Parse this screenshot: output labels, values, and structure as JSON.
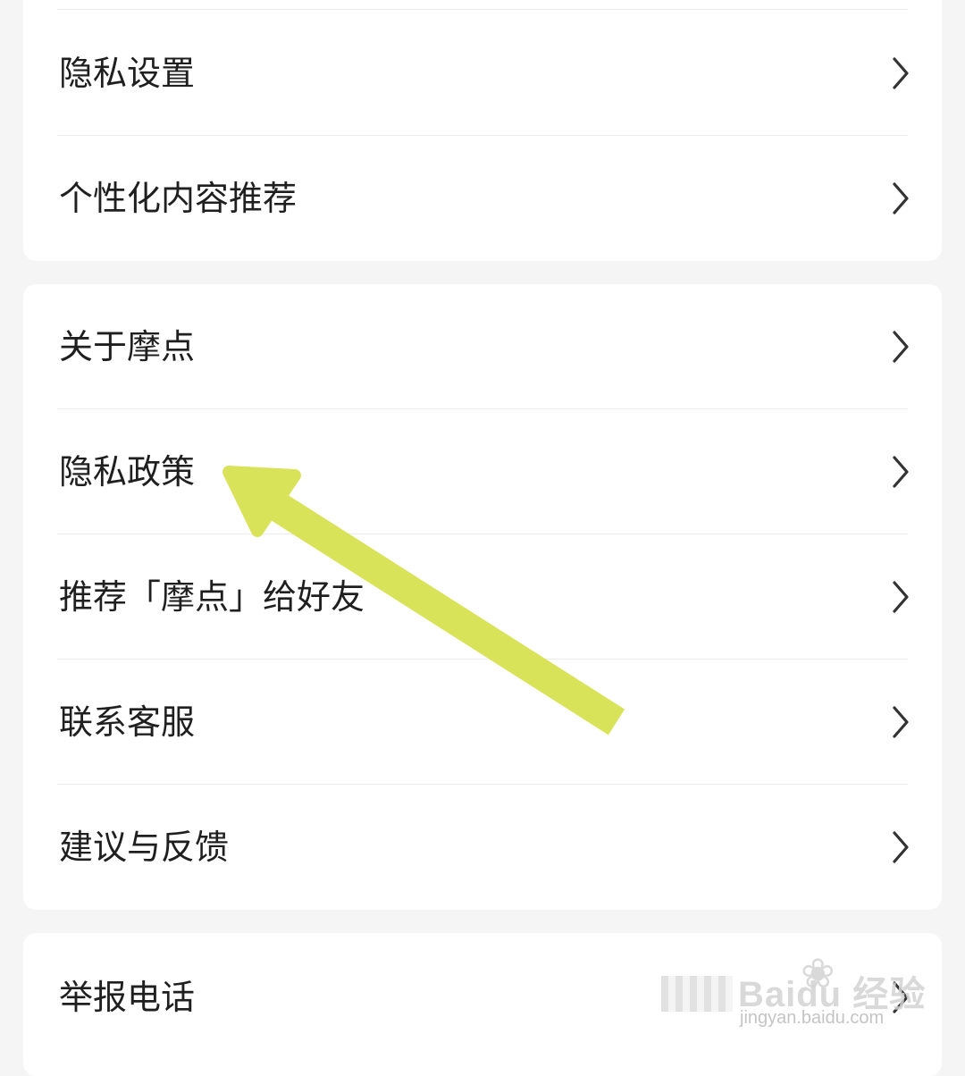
{
  "settings_group_1": {
    "items": [
      {
        "label": "隐私设置"
      },
      {
        "label": "个性化内容推荐"
      }
    ]
  },
  "settings_group_2": {
    "items": [
      {
        "label": "关于摩点"
      },
      {
        "label": "隐私政策"
      },
      {
        "label": "推荐「摩点」给好友"
      },
      {
        "label": "联系客服"
      },
      {
        "label": "建议与反馈"
      }
    ]
  },
  "settings_group_3": {
    "items": [
      {
        "label": "举报电话"
      }
    ]
  },
  "annotation": {
    "arrow_color": "#d9e35a",
    "points_to": "隐私政策"
  },
  "watermark": {
    "logo_text": "Baidu 经验",
    "url_text": "jingyan.baidu.com"
  },
  "colors": {
    "background": "#f5f5f5",
    "card": "#ffffff",
    "text": "#1f1f1f",
    "chevron": "#333333",
    "divider": "#ececec"
  }
}
